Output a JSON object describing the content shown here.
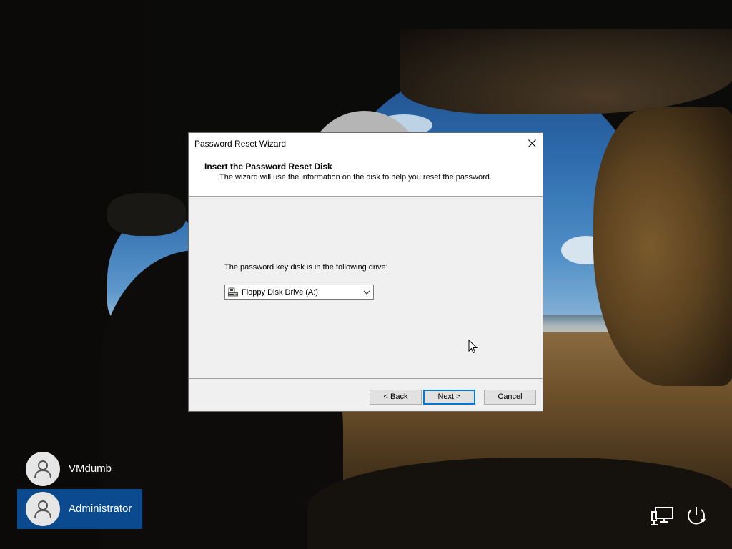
{
  "dialog": {
    "title": "Password Reset Wizard",
    "header_title": "Insert the Password Reset Disk",
    "header_subtitle": "The wizard will use the information on the disk to help you reset the password.",
    "prompt": "The password key disk is in the following drive:",
    "drive_select": {
      "selected": "Floppy Disk Drive (A:)",
      "icon": "floppy-drive-icon"
    },
    "buttons": {
      "back": "< Back",
      "next": "Next >",
      "cancel": "Cancel"
    },
    "close_icon": "close-icon"
  },
  "users": [
    {
      "name": "VMdumb",
      "icon": "user-avatar-icon",
      "selected": false
    },
    {
      "name": "Administrator",
      "icon": "user-avatar-icon",
      "selected": true
    }
  ],
  "system_icons": {
    "network": "network-icon",
    "power": "power-icon"
  },
  "colors": {
    "accent": "#0078d7",
    "selected_user_bg": "#0b4a8f",
    "dialog_bg": "#f0f0f0"
  }
}
